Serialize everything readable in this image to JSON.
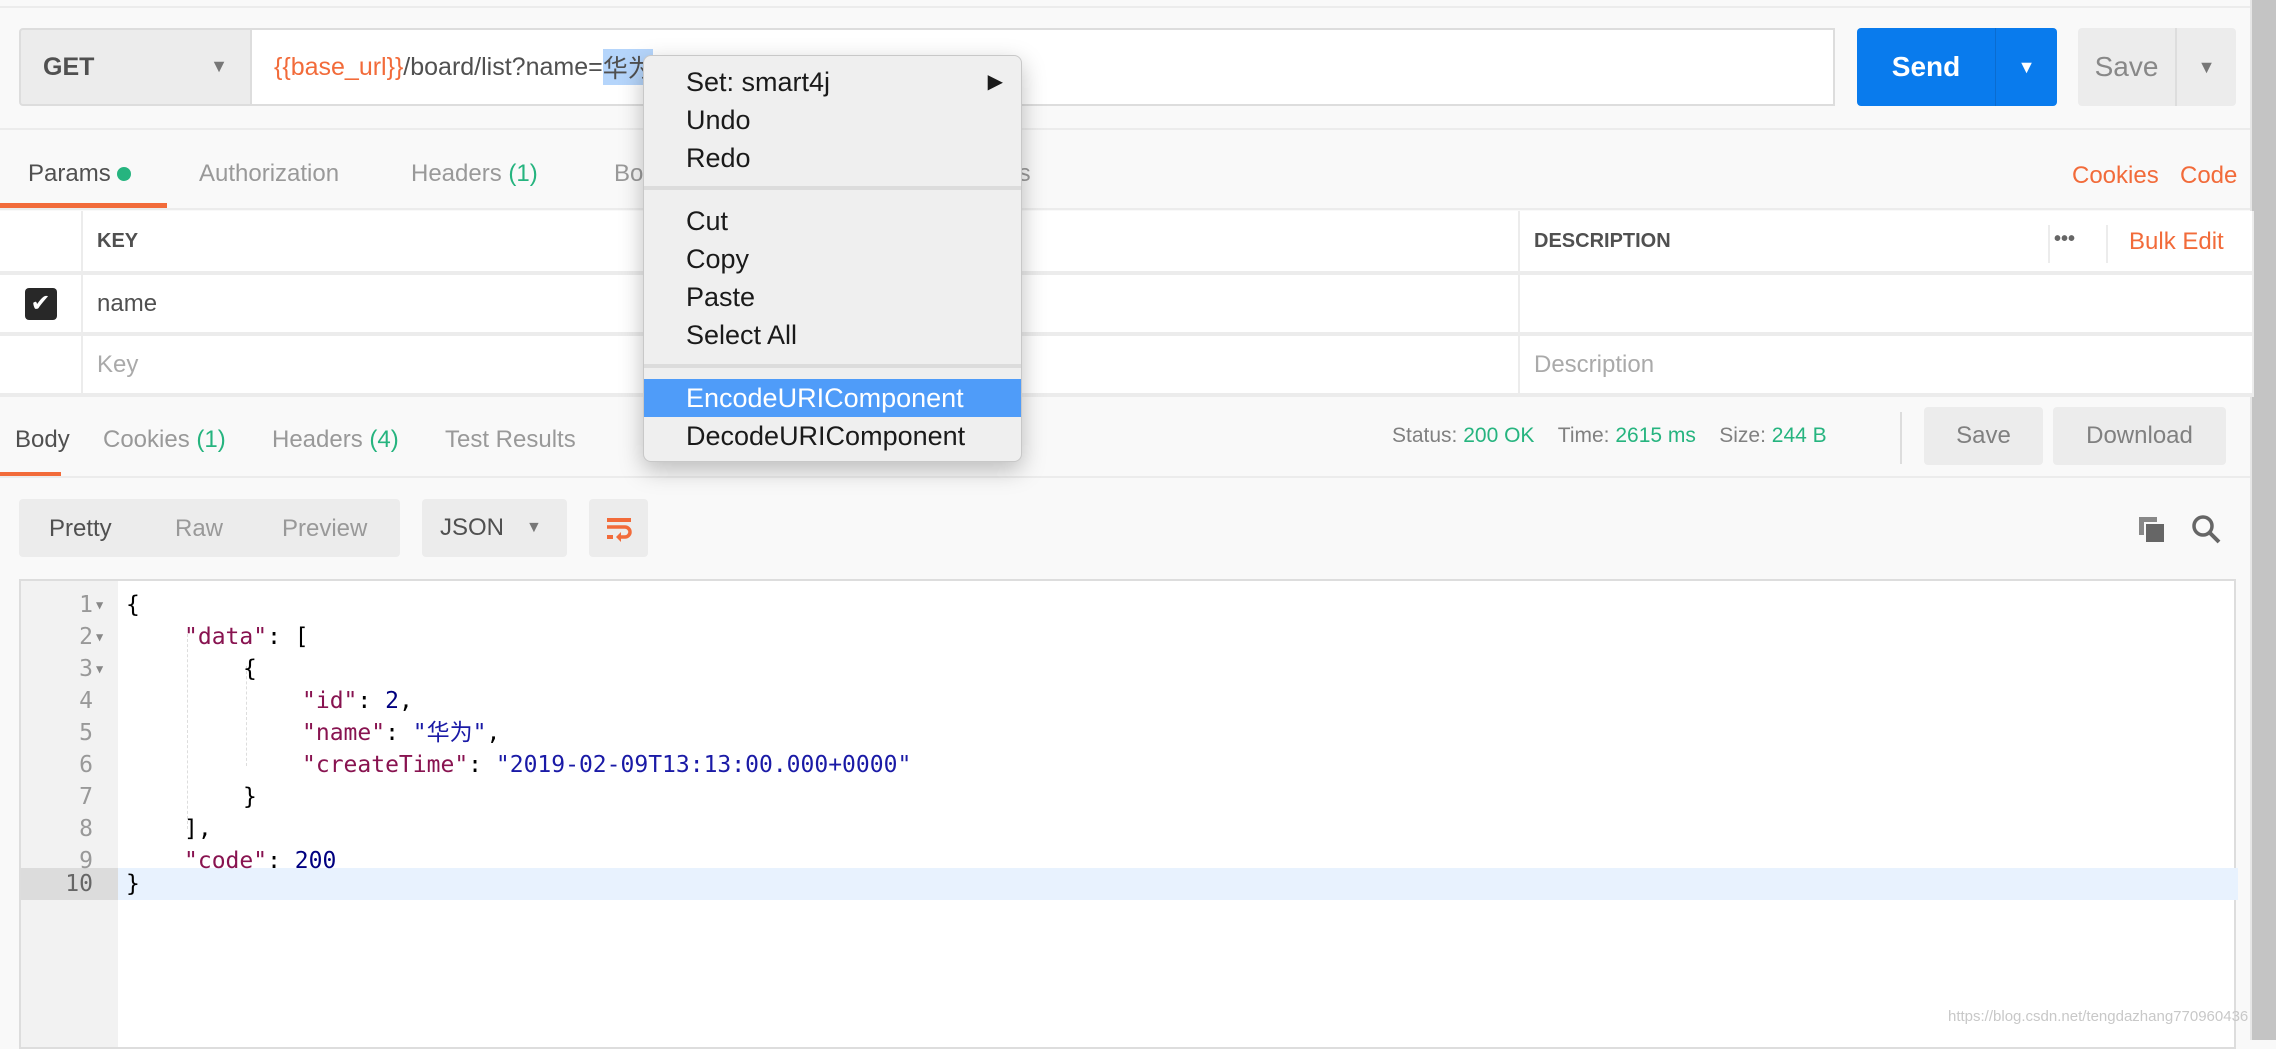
{
  "request": {
    "method": "GET",
    "url_var": "{{base_url}}",
    "url_path": "/board/list?name=",
    "url_selected": "华为",
    "send_label": "Send",
    "save_label": "Save"
  },
  "request_tabs": [
    {
      "label": "Params",
      "active": true,
      "dot_color": "#26b47f"
    },
    {
      "label": "Authorization"
    },
    {
      "label": "Headers",
      "count": "(1)"
    },
    {
      "label": "Bo"
    },
    {
      "label": "sts"
    }
  ],
  "request_links": {
    "cookies": "Cookies",
    "code": "Code"
  },
  "params_table": {
    "headers": {
      "key": "KEY",
      "description": "DESCRIPTION",
      "more": "•••",
      "bulk_edit": "Bulk Edit"
    },
    "rows": [
      {
        "checked": true,
        "key": "name",
        "description": ""
      }
    ],
    "placeholders": {
      "key": "Key",
      "description": "Description"
    }
  },
  "response_tabs": [
    {
      "label": "Body",
      "active": true
    },
    {
      "label": "Cookies",
      "count": "(1)"
    },
    {
      "label": "Headers",
      "count": "(4)"
    },
    {
      "label": "Test Results"
    }
  ],
  "response_status": {
    "status_label": "Status:",
    "status": "200 OK",
    "time_label": "Time:",
    "time": "2615 ms",
    "size_label": "Size:",
    "size": "244 B",
    "save_label": "Save",
    "download_label": "Download"
  },
  "view_modes": [
    "Pretty",
    "Raw",
    "Preview"
  ],
  "format": "JSON",
  "code_lines": [
    {
      "n": "1",
      "fold": true
    },
    {
      "n": "2",
      "fold": true
    },
    {
      "n": "3",
      "fold": true
    },
    {
      "n": "4"
    },
    {
      "n": "5"
    },
    {
      "n": "6"
    },
    {
      "n": "7"
    },
    {
      "n": "8"
    },
    {
      "n": "9"
    },
    {
      "n": "10",
      "active": true
    }
  ],
  "code": {
    "l1": "{",
    "l2k": "\"data\"",
    "l2r": ": [",
    "l3": "{",
    "l4k": "\"id\"",
    "l4v": "2",
    "l4e": ",",
    "l5k": "\"name\"",
    "l5v": "\"华为\"",
    "l5e": ",",
    "l6k": "\"createTime\"",
    "l6v": "\"2019-02-09T13:13:00.000+0000\"",
    "l7": "}",
    "l8": "],",
    "l9k": "\"code\"",
    "l9v": "200",
    "l10": "}",
    "sep": ": "
  },
  "context_menu": {
    "items": [
      "Set: smart4j",
      "Undo",
      "Redo",
      "Cut",
      "Copy",
      "Paste",
      "Select All",
      "EncodeURIComponent",
      "DecodeURIComponent"
    ],
    "highlighted": "EncodeURIComponent",
    "submenu_arrow": "▶"
  },
  "watermark": "https://blog.csdn.net/tengdazhang770960436",
  "colors": {
    "accent": "#f26b3a",
    "send": "#097bed",
    "success": "#26b47f",
    "highlight": "#4f9cf9"
  }
}
